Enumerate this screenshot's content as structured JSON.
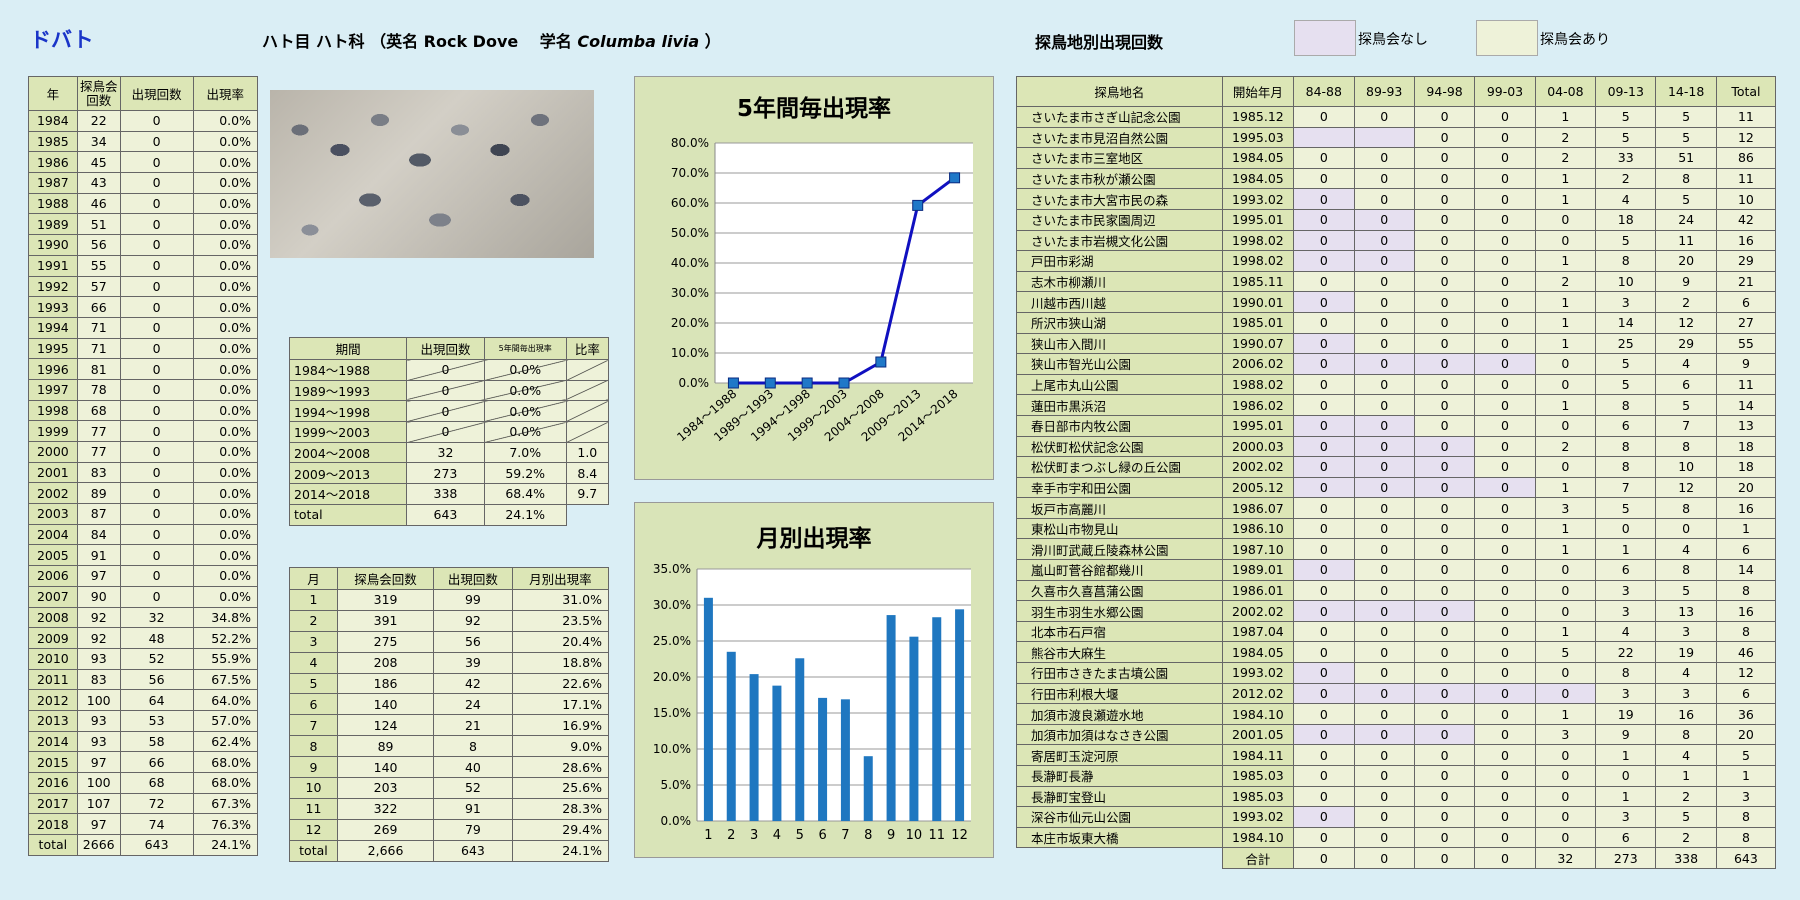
{
  "page_title": "ドバト",
  "header": {
    "prefix": "ハト目 ハト科 （英名 Rock Dove　 学名 ",
    "scientific": "Columba livia",
    "suffix": " ）"
  },
  "site_section_title": "探鳥地別出現回数",
  "legend": {
    "no_meeting": "探鳥会なし",
    "meeting": "探鳥会あり",
    "no_meeting_color": "#e6e0f0",
    "meeting_color": "#eef2d9"
  },
  "yearly": {
    "headers": [
      "年",
      "探鳥会回数",
      "出現回数",
      "出現率"
    ],
    "rows": [
      [
        "1984",
        "22",
        "0",
        "0.0%"
      ],
      [
        "1985",
        "34",
        "0",
        "0.0%"
      ],
      [
        "1986",
        "45",
        "0",
        "0.0%"
      ],
      [
        "1987",
        "43",
        "0",
        "0.0%"
      ],
      [
        "1988",
        "46",
        "0",
        "0.0%"
      ],
      [
        "1989",
        "51",
        "0",
        "0.0%"
      ],
      [
        "1990",
        "56",
        "0",
        "0.0%"
      ],
      [
        "1991",
        "55",
        "0",
        "0.0%"
      ],
      [
        "1992",
        "57",
        "0",
        "0.0%"
      ],
      [
        "1993",
        "66",
        "0",
        "0.0%"
      ],
      [
        "1994",
        "71",
        "0",
        "0.0%"
      ],
      [
        "1995",
        "71",
        "0",
        "0.0%"
      ],
      [
        "1996",
        "81",
        "0",
        "0.0%"
      ],
      [
        "1997",
        "78",
        "0",
        "0.0%"
      ],
      [
        "1998",
        "68",
        "0",
        "0.0%"
      ],
      [
        "1999",
        "77",
        "0",
        "0.0%"
      ],
      [
        "2000",
        "77",
        "0",
        "0.0%"
      ],
      [
        "2001",
        "83",
        "0",
        "0.0%"
      ],
      [
        "2002",
        "89",
        "0",
        "0.0%"
      ],
      [
        "2003",
        "87",
        "0",
        "0.0%"
      ],
      [
        "2004",
        "84",
        "0",
        "0.0%"
      ],
      [
        "2005",
        "91",
        "0",
        "0.0%"
      ],
      [
        "2006",
        "97",
        "0",
        "0.0%"
      ],
      [
        "2007",
        "90",
        "0",
        "0.0%"
      ],
      [
        "2008",
        "92",
        "32",
        "34.8%"
      ],
      [
        "2009",
        "92",
        "48",
        "52.2%"
      ],
      [
        "2010",
        "93",
        "52",
        "55.9%"
      ],
      [
        "2011",
        "83",
        "56",
        "67.5%"
      ],
      [
        "2012",
        "100",
        "64",
        "64.0%"
      ],
      [
        "2013",
        "93",
        "53",
        "57.0%"
      ],
      [
        "2014",
        "93",
        "58",
        "62.4%"
      ],
      [
        "2015",
        "97",
        "66",
        "68.0%"
      ],
      [
        "2016",
        "100",
        "68",
        "68.0%"
      ],
      [
        "2017",
        "107",
        "72",
        "67.3%"
      ],
      [
        "2018",
        "97",
        "74",
        "76.3%"
      ],
      [
        "total",
        "2666",
        "643",
        "24.1%"
      ]
    ]
  },
  "period": {
    "headers": [
      "期間",
      "出現回数",
      "5年間毎出現率",
      "比率"
    ],
    "rows": [
      [
        "1984～1988",
        "0",
        "0.0%",
        ""
      ],
      [
        "1989～1993",
        "0",
        "0.0%",
        ""
      ],
      [
        "1994～1998",
        "0",
        "0.0%",
        ""
      ],
      [
        "1999～2003",
        "0",
        "0.0%",
        ""
      ],
      [
        "2004～2008",
        "32",
        "7.0%",
        "1.0"
      ],
      [
        "2009～2013",
        "273",
        "59.2%",
        "8.4"
      ],
      [
        "2014～2018",
        "338",
        "68.4%",
        "9.7"
      ]
    ],
    "total": [
      "total",
      "643",
      "24.1%"
    ]
  },
  "monthly": {
    "headers": [
      "月",
      "探鳥会回数",
      "出現回数",
      "月別出現率"
    ],
    "rows": [
      [
        "1",
        "319",
        "99",
        "31.0%"
      ],
      [
        "2",
        "391",
        "92",
        "23.5%"
      ],
      [
        "3",
        "275",
        "56",
        "20.4%"
      ],
      [
        "4",
        "208",
        "39",
        "18.8%"
      ],
      [
        "5",
        "186",
        "42",
        "22.6%"
      ],
      [
        "6",
        "140",
        "24",
        "17.1%"
      ],
      [
        "7",
        "124",
        "21",
        "16.9%"
      ],
      [
        "8",
        "89",
        "8",
        "9.0%"
      ],
      [
        "9",
        "140",
        "40",
        "28.6%"
      ],
      [
        "10",
        "203",
        "52",
        "25.6%"
      ],
      [
        "11",
        "322",
        "91",
        "28.3%"
      ],
      [
        "12",
        "269",
        "79",
        "29.4%"
      ],
      [
        "total",
        "2,666",
        "643",
        "24.1%"
      ]
    ]
  },
  "sites": {
    "headers": [
      "探鳥地名",
      "開始年月",
      "84-88",
      "89-93",
      "94-98",
      "99-03",
      "04-08",
      "09-13",
      "14-18",
      "Total"
    ],
    "rows": [
      {
        "name": "さいたま市さぎ山記念公園",
        "start": "1985.12",
        "v": [
          "0",
          "0",
          "0",
          "0",
          "1",
          "5",
          "5",
          "11"
        ],
        "nm": []
      },
      {
        "name": "さいたま市見沼自然公園",
        "start": "1995.03",
        "v": [
          "",
          "",
          "0",
          "0",
          "2",
          "5",
          "5",
          "12"
        ],
        "nm": [
          0,
          1
        ]
      },
      {
        "name": "さいたま市三室地区",
        "start": "1984.05",
        "v": [
          "0",
          "0",
          "0",
          "0",
          "2",
          "33",
          "51",
          "86"
        ],
        "nm": []
      },
      {
        "name": "さいたま市秋が瀬公園",
        "start": "1984.05",
        "v": [
          "0",
          "0",
          "0",
          "0",
          "1",
          "2",
          "8",
          "11"
        ],
        "nm": []
      },
      {
        "name": "さいたま市大宮市民の森",
        "start": "1993.02",
        "v": [
          "0",
          "0",
          "0",
          "0",
          "1",
          "4",
          "5",
          "10"
        ],
        "nm": [
          0
        ]
      },
      {
        "name": "さいたま市民家園周辺",
        "start": "1995.01",
        "v": [
          "0",
          "0",
          "0",
          "0",
          "0",
          "18",
          "24",
          "42"
        ],
        "nm": [
          0,
          1
        ]
      },
      {
        "name": "さいたま市岩槻文化公園",
        "start": "1998.02",
        "v": [
          "0",
          "0",
          "0",
          "0",
          "0",
          "5",
          "11",
          "16"
        ],
        "nm": [
          0,
          1
        ]
      },
      {
        "name": "戸田市彩湖",
        "start": "1998.02",
        "v": [
          "0",
          "0",
          "0",
          "0",
          "1",
          "8",
          "20",
          "29"
        ],
        "nm": [
          0,
          1
        ]
      },
      {
        "name": "志木市柳瀬川",
        "start": "1985.11",
        "v": [
          "0",
          "0",
          "0",
          "0",
          "2",
          "10",
          "9",
          "21"
        ],
        "nm": []
      },
      {
        "name": "川越市西川越",
        "start": "1990.01",
        "v": [
          "0",
          "0",
          "0",
          "0",
          "1",
          "3",
          "2",
          "6"
        ],
        "nm": [
          0
        ]
      },
      {
        "name": "所沢市狭山湖",
        "start": "1985.01",
        "v": [
          "0",
          "0",
          "0",
          "0",
          "1",
          "14",
          "12",
          "27"
        ],
        "nm": []
      },
      {
        "name": "狭山市入間川",
        "start": "1990.07",
        "v": [
          "0",
          "0",
          "0",
          "0",
          "1",
          "25",
          "29",
          "55"
        ],
        "nm": [
          0
        ]
      },
      {
        "name": "狭山市智光山公園",
        "start": "2006.02",
        "v": [
          "0",
          "0",
          "0",
          "0",
          "0",
          "5",
          "4",
          "9"
        ],
        "nm": [
          0,
          1,
          2,
          3
        ]
      },
      {
        "name": "上尾市丸山公園",
        "start": "1988.02",
        "v": [
          "0",
          "0",
          "0",
          "0",
          "0",
          "5",
          "6",
          "11"
        ],
        "nm": []
      },
      {
        "name": "蓮田市黒浜沼",
        "start": "1986.02",
        "v": [
          "0",
          "0",
          "0",
          "0",
          "1",
          "8",
          "5",
          "14"
        ],
        "nm": []
      },
      {
        "name": "春日部市内牧公園",
        "start": "1995.01",
        "v": [
          "0",
          "0",
          "0",
          "0",
          "0",
          "6",
          "7",
          "13"
        ],
        "nm": [
          0,
          1
        ]
      },
      {
        "name": "松伏町松伏記念公園",
        "start": "2000.03",
        "v": [
          "0",
          "0",
          "0",
          "0",
          "2",
          "8",
          "8",
          "18"
        ],
        "nm": [
          0,
          1,
          2
        ]
      },
      {
        "name": "松伏町まつぶし緑の丘公園",
        "start": "2002.02",
        "v": [
          "0",
          "0",
          "0",
          "0",
          "0",
          "8",
          "10",
          "18"
        ],
        "nm": [
          0,
          1,
          2
        ]
      },
      {
        "name": "幸手市宇和田公園",
        "start": "2005.12",
        "v": [
          "0",
          "0",
          "0",
          "0",
          "1",
          "7",
          "12",
          "20"
        ],
        "nm": [
          0,
          1,
          2,
          3
        ]
      },
      {
        "name": "坂戸市高麗川",
        "start": "1986.07",
        "v": [
          "0",
          "0",
          "0",
          "0",
          "3",
          "5",
          "8",
          "16"
        ],
        "nm": []
      },
      {
        "name": "東松山市物見山",
        "start": "1986.10",
        "v": [
          "0",
          "0",
          "0",
          "0",
          "1",
          "0",
          "0",
          "1"
        ],
        "nm": []
      },
      {
        "name": "滑川町武蔵丘陵森林公園",
        "start": "1987.10",
        "v": [
          "0",
          "0",
          "0",
          "0",
          "1",
          "1",
          "4",
          "6"
        ],
        "nm": []
      },
      {
        "name": "嵐山町菅谷館都幾川",
        "start": "1989.01",
        "v": [
          "0",
          "0",
          "0",
          "0",
          "0",
          "6",
          "8",
          "14"
        ],
        "nm": [
          0
        ]
      },
      {
        "name": "久喜市久喜菖蒲公園",
        "start": "1986.01",
        "v": [
          "0",
          "0",
          "0",
          "0",
          "0",
          "3",
          "5",
          "8"
        ],
        "nm": []
      },
      {
        "name": "羽生市羽生水郷公園",
        "start": "2002.02",
        "v": [
          "0",
          "0",
          "0",
          "0",
          "0",
          "3",
          "13",
          "16"
        ],
        "nm": [
          0,
          1,
          2
        ]
      },
      {
        "name": "北本市石戸宿",
        "start": "1987.04",
        "v": [
          "0",
          "0",
          "0",
          "0",
          "1",
          "4",
          "3",
          "8"
        ],
        "nm": []
      },
      {
        "name": "熊谷市大麻生",
        "start": "1984.05",
        "v": [
          "0",
          "0",
          "0",
          "0",
          "5",
          "22",
          "19",
          "46"
        ],
        "nm": []
      },
      {
        "name": "行田市さきたま古墳公園",
        "start": "1993.02",
        "v": [
          "0",
          "0",
          "0",
          "0",
          "0",
          "8",
          "4",
          "12"
        ],
        "nm": [
          0
        ]
      },
      {
        "name": "行田市利根大堰",
        "start": "2012.02",
        "v": [
          "0",
          "0",
          "0",
          "0",
          "0",
          "3",
          "3",
          "6"
        ],
        "nm": [
          0,
          1,
          2,
          3,
          4
        ]
      },
      {
        "name": "加須市渡良瀬遊水地",
        "start": "1984.10",
        "v": [
          "0",
          "0",
          "0",
          "0",
          "1",
          "19",
          "16",
          "36"
        ],
        "nm": []
      },
      {
        "name": "加須市加須はなさき公園",
        "start": "2001.05",
        "v": [
          "0",
          "0",
          "0",
          "0",
          "3",
          "9",
          "8",
          "20"
        ],
        "nm": [
          0,
          1,
          2
        ]
      },
      {
        "name": "寄居町玉淀河原",
        "start": "1984.11",
        "v": [
          "0",
          "0",
          "0",
          "0",
          "0",
          "1",
          "4",
          "5"
        ],
        "nm": []
      },
      {
        "name": "長瀞町長瀞",
        "start": "1985.03",
        "v": [
          "0",
          "0",
          "0",
          "0",
          "0",
          "0",
          "1",
          "1"
        ],
        "nm": []
      },
      {
        "name": "長瀞町宝登山",
        "start": "1985.03",
        "v": [
          "0",
          "0",
          "0",
          "0",
          "0",
          "1",
          "2",
          "3"
        ],
        "nm": []
      },
      {
        "name": "深谷市仙元山公園",
        "start": "1993.02",
        "v": [
          "0",
          "0",
          "0",
          "0",
          "0",
          "3",
          "5",
          "8"
        ],
        "nm": [
          0
        ]
      },
      {
        "name": "本庄市坂東大橋",
        "start": "1984.10",
        "v": [
          "0",
          "0",
          "0",
          "0",
          "0",
          "6",
          "2",
          "8"
        ],
        "nm": []
      }
    ],
    "total_label": "合計",
    "totals": [
      "0",
      "0",
      "0",
      "0",
      "32",
      "273",
      "338",
      "643"
    ]
  },
  "chart_data": [
    {
      "type": "line",
      "title": "5年間毎出現率",
      "categories": [
        "1984～1988",
        "1989～1993",
        "1994～1998",
        "1999～2003",
        "2004～2008",
        "2009～2013",
        "2014～2018"
      ],
      "values": [
        0.0,
        0.0,
        0.0,
        0.0,
        7.0,
        59.2,
        68.4
      ],
      "ylim": [
        0,
        80
      ],
      "yticks": [
        "0.0%",
        "10.0%",
        "20.0%",
        "30.0%",
        "40.0%",
        "50.0%",
        "60.0%",
        "70.0%",
        "80.0%"
      ],
      "color": "#1010c0",
      "marker_color": "#1f78c8",
      "grid": true
    },
    {
      "type": "bar",
      "title": "月別出現率",
      "categories": [
        "1",
        "2",
        "3",
        "4",
        "5",
        "6",
        "7",
        "8",
        "9",
        "10",
        "11",
        "12"
      ],
      "values": [
        31.0,
        23.5,
        20.4,
        18.8,
        22.6,
        17.1,
        16.9,
        9.0,
        28.6,
        25.6,
        28.3,
        29.4
      ],
      "ylim": [
        0,
        35
      ],
      "yticks": [
        "0.0%",
        "5.0%",
        "10.0%",
        "15.0%",
        "20.0%",
        "25.0%",
        "30.0%",
        "35.0%"
      ],
      "color": "#1f77c0",
      "grid": true
    }
  ]
}
